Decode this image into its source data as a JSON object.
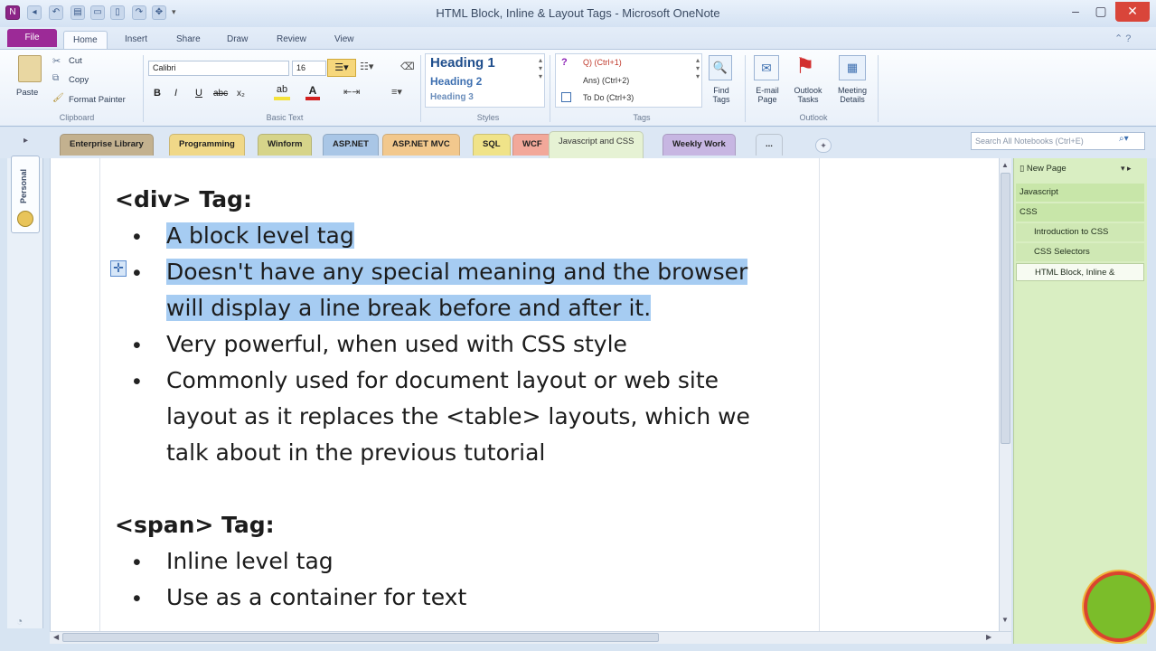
{
  "window": {
    "title": "HTML Block, Inline & Layout Tags - Microsoft OneNote"
  },
  "ribbon_tabs": [
    "File",
    "Home",
    "Insert",
    "Share",
    "Draw",
    "Review",
    "View"
  ],
  "clipboard": {
    "paste": "Paste",
    "cut": "Cut",
    "copy": "Copy",
    "format_painter": "Format Painter",
    "label": "Clipboard"
  },
  "basic_text": {
    "font": "Calibri",
    "size": "16",
    "label": "Basic Text",
    "bold": "B",
    "italic": "I",
    "underline": "U",
    "strike": "abc",
    "subscript": "x₂"
  },
  "styles": {
    "items": [
      "Heading 1",
      "Heading 2",
      "Heading 3"
    ],
    "label": "Styles"
  },
  "tags": {
    "items": [
      "Q) (Ctrl+1)",
      "Ans) (Ctrl+2)",
      "To Do (Ctrl+3)"
    ],
    "find": "Find Tags",
    "label": "Tags"
  },
  "outlook": {
    "email": "E-mail Page",
    "tasks": "Outlook Tasks",
    "meeting": "Meeting Details",
    "label": "Outlook"
  },
  "sections": [
    {
      "label": "Enterprise Library",
      "color": "#c3b18f"
    },
    {
      "label": "Programming",
      "color": "#f0d888"
    },
    {
      "label": "Winform",
      "color": "#d6d48a"
    },
    {
      "label": "ASP.NET",
      "color": "#a9c6e6"
    },
    {
      "label": "ASP.NET MVC",
      "color": "#f2c88d"
    },
    {
      "label": "SQL",
      "color": "#f0e389"
    },
    {
      "label": "WCF",
      "color": "#f2a89a"
    },
    {
      "label": "Javascript and CSS",
      "color": "#e6f2d4"
    },
    {
      "label": "Weekly Work",
      "color": "#c7b6e2"
    },
    {
      "label": "...",
      "color": "#dce7f4"
    }
  ],
  "search": {
    "placeholder": "Search All Notebooks (Ctrl+E)"
  },
  "notebook": {
    "name": "Personal"
  },
  "page_content": {
    "div_heading": "<div> Tag:",
    "div_items": [
      "A block level tag",
      "Doesn't have any special meaning and the browser",
      "will display a line break before and after it.",
      "Very powerful, when used with CSS style",
      "Commonly used for document layout or web site",
      "layout as it replaces the <table> layouts, which we",
      "talk about in the previous tutorial"
    ],
    "span_heading": "<span> Tag:",
    "span_items": [
      "Inline level tag",
      "Use as a container for text"
    ]
  },
  "page_pane": {
    "new_page": "New Page",
    "pages": [
      {
        "title": "Javascript",
        "level": 0
      },
      {
        "title": "CSS",
        "level": 0
      },
      {
        "title": "Introduction to CSS",
        "level": 1
      },
      {
        "title": "CSS Selectors",
        "level": 1
      },
      {
        "title": "HTML Block, Inline &",
        "level": 1
      }
    ]
  },
  "colors": {
    "file_tab": "#9c2a97",
    "selection": "#a6ccf2",
    "page_pane": "#d9eec2"
  }
}
